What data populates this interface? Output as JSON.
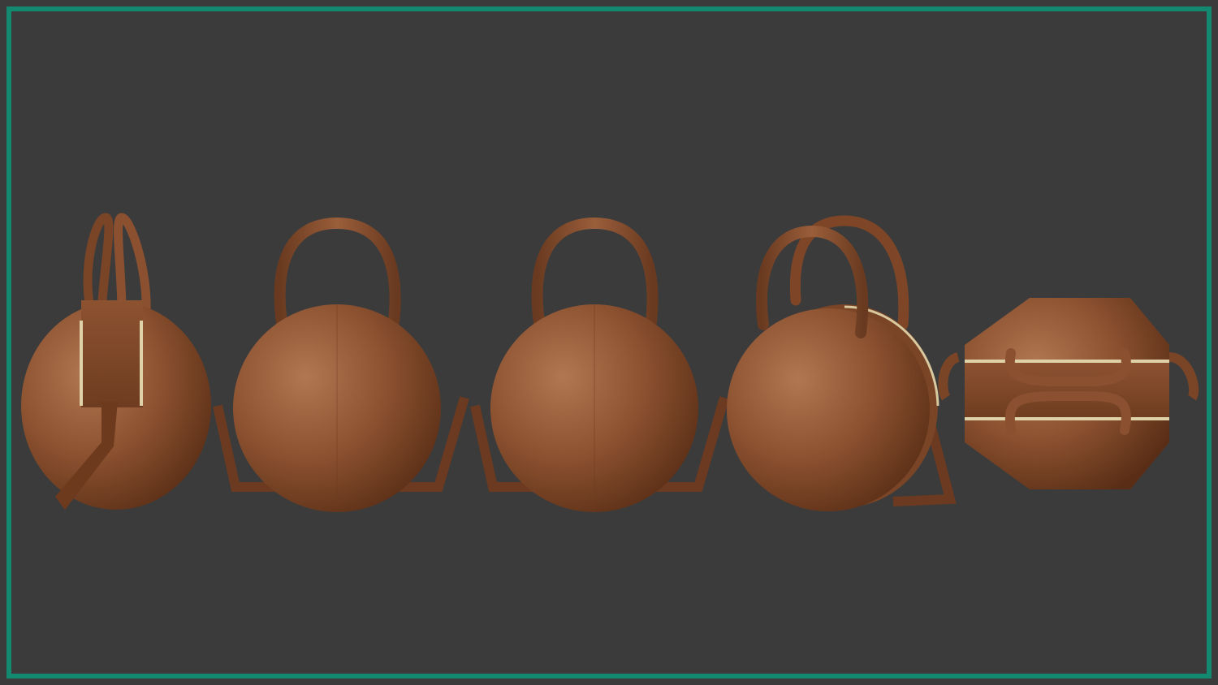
{
  "colors": {
    "background": "#3a3a3a",
    "frame": "#13896f",
    "leather": "#8a4f2c",
    "trim": "#d8c9a0"
  },
  "views": [
    "side",
    "front",
    "back",
    "three-quarter",
    "top"
  ]
}
